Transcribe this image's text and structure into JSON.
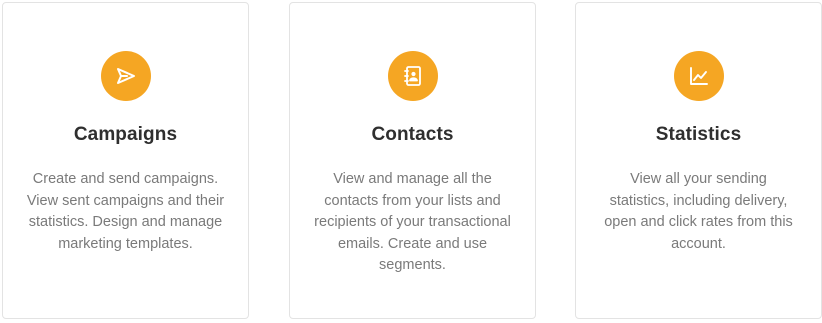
{
  "accent_color": "#f5a623",
  "cards": [
    {
      "icon": "send-icon",
      "title": "Campaigns",
      "lines": [
        "Create and send campaigns.",
        "View sent campaigns and their",
        "statistics. Design and manage",
        "marketing templates."
      ]
    },
    {
      "icon": "contacts-book-icon",
      "title": "Contacts",
      "lines": [
        "View and manage all the",
        "contacts from your lists and",
        "recipients of your transactional",
        "emails. Create and use",
        "segments."
      ]
    },
    {
      "icon": "line-chart-icon",
      "title": "Statistics",
      "lines": [
        "View all your sending",
        "statistics, including delivery,",
        "open and click rates from this",
        "account."
      ]
    }
  ]
}
